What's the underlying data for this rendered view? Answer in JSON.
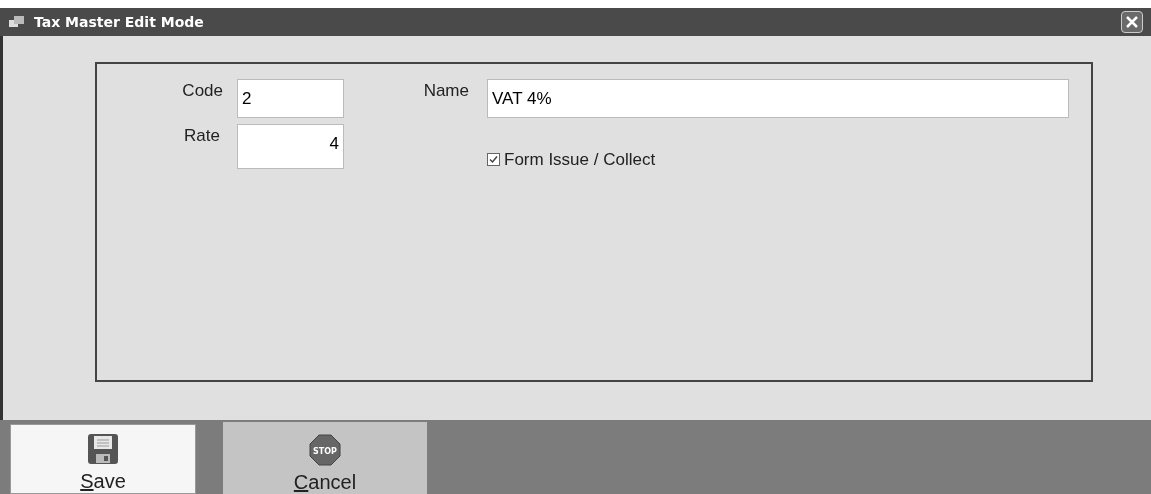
{
  "window": {
    "title": "Tax Master Edit Mode"
  },
  "fields": [
    {
      "label": "Code",
      "value": "2"
    },
    {
      "label": "Name",
      "value": "VAT 4%"
    },
    {
      "label": "Rate",
      "value": "4"
    }
  ],
  "form_issue": {
    "label": "Form Issue / Collect",
    "checked": true
  },
  "buttons": [
    {
      "kind": "save",
      "label": "Save",
      "selected": true,
      "mnemonic_first": true
    },
    {
      "kind": "cancel",
      "label": "Cancel",
      "selected": false,
      "mnemonic_first": true,
      "icon_text": "STOP"
    }
  ]
}
